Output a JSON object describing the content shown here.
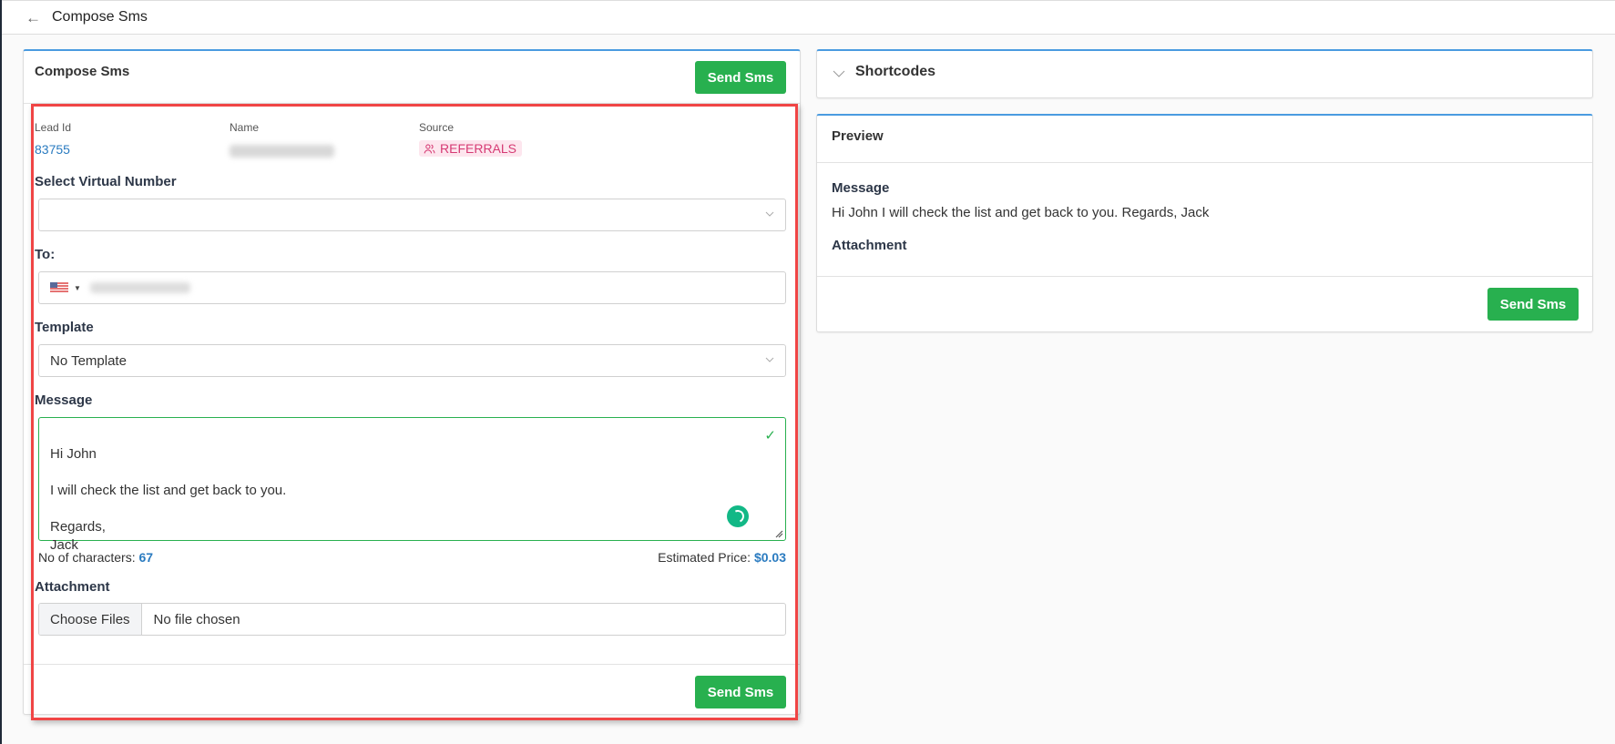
{
  "topbar": {
    "back_icon": "arrow-left-icon",
    "title": "Compose Sms"
  },
  "compose": {
    "title": "Compose Sms",
    "send_label": "Send Sms",
    "lead": {
      "lead_id_label": "Lead Id",
      "lead_id_value": "83755",
      "name_label": "Name",
      "source_label": "Source",
      "source_value": "REFERRALS",
      "source_icon": "users-icon"
    },
    "virtual_number": {
      "label": "Select Virtual Number",
      "value": ""
    },
    "to": {
      "label": "To:",
      "country": "US"
    },
    "template": {
      "label": "Template",
      "value": "No Template"
    },
    "message": {
      "label": "Message",
      "value": "Hi John\n\nI will check the list and get back to you.\n\nRegards,\nJack"
    },
    "chars_label": "No of characters:",
    "chars_value": "67",
    "price_label": "Estimated Price:",
    "price_value": "$0.03",
    "attachment": {
      "label": "Attachment",
      "button": "Choose Files",
      "status": "No file chosen"
    },
    "footer_send_label": "Send Sms"
  },
  "shortcodes": {
    "title": "Shortcodes"
  },
  "preview": {
    "title": "Preview",
    "message_label": "Message",
    "message_text": "Hi John I will check the list and get back to you. Regards, Jack",
    "attachment_label": "Attachment",
    "send_label": "Send Sms"
  },
  "colors": {
    "accent": "#4a9be0",
    "success": "#28b04f",
    "link": "#2a7bc0",
    "highlight": "#f04545",
    "badge_text": "#d63b74",
    "badge_bg": "#fde6ee"
  }
}
